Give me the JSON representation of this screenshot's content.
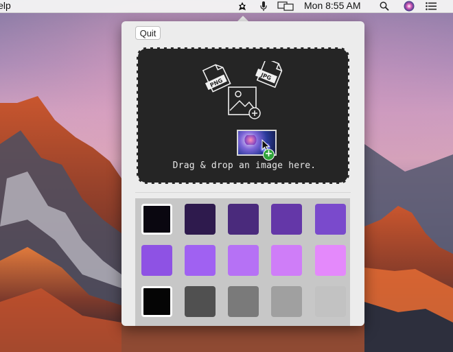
{
  "menubar": {
    "app_menu_partial": "Help",
    "clock": "Mon 8:55 AM",
    "icons": [
      "app-status-icon",
      "microphone-icon",
      "display-mirroring-icon",
      "spotlight-search-icon",
      "siri-icon",
      "notification-center-icon"
    ]
  },
  "popover": {
    "quit_label": "Quit",
    "drop_zone": {
      "instruction": "Drag & drop an image here.",
      "file_badges": [
        "PNG",
        "JPG"
      ]
    },
    "palette": {
      "rows": [
        [
          "#0a0710",
          "#2e1a4d",
          "#4a2a7c",
          "#6437a8",
          "#7a4acc"
        ],
        [
          "#8e52e4",
          "#a061f2",
          "#b671f5",
          "#cf7df8",
          "#e489fb"
        ],
        [
          "#050505",
          "#505050",
          "#7a7a7a",
          "#a0a0a0",
          "#c2c2c2"
        ]
      ],
      "selected": [
        [
          0,
          0
        ],
        [
          2,
          0
        ]
      ]
    }
  }
}
